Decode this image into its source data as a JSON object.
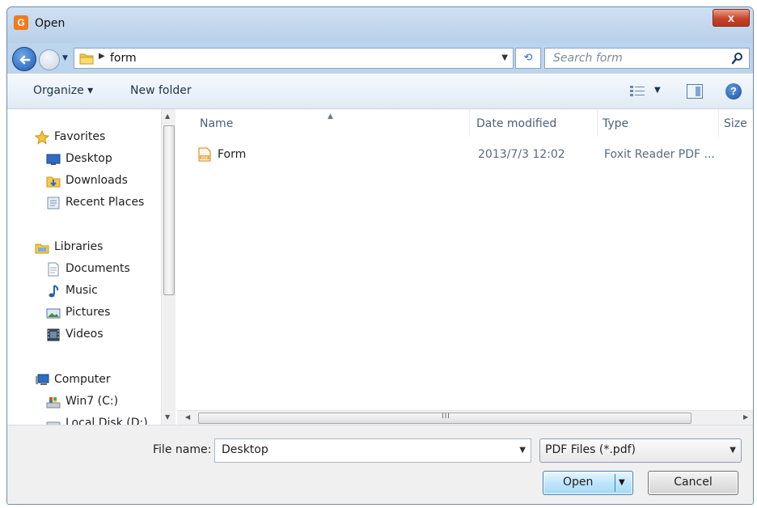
{
  "window": {
    "title": "Open",
    "app_icon_letter": "G",
    "close_label": "x"
  },
  "navigation": {
    "breadcrumb": "form",
    "search_placeholder": "Search form"
  },
  "toolbar": {
    "organize_label": "Organize ▾",
    "new_folder_label": "New folder"
  },
  "sidebar": {
    "favorites": {
      "label": "Favorites",
      "icon": "star-icon"
    },
    "favorites_items": [
      {
        "label": "Desktop",
        "icon": "desktop-icon"
      },
      {
        "label": "Downloads",
        "icon": "downloads-icon"
      },
      {
        "label": "Recent Places",
        "icon": "recent-places-icon"
      }
    ],
    "libraries": {
      "label": "Libraries",
      "icon": "libraries-icon"
    },
    "libraries_items": [
      {
        "label": "Documents",
        "icon": "documents-icon"
      },
      {
        "label": "Music",
        "icon": "music-icon"
      },
      {
        "label": "Pictures",
        "icon": "pictures-icon"
      },
      {
        "label": "Videos",
        "icon": "videos-icon"
      }
    ],
    "computer": {
      "label": "Computer",
      "icon": "computer-icon"
    },
    "computer_items": [
      {
        "label": "Win7 (C:)",
        "icon": "drive-c-icon"
      },
      {
        "label": "Local Disk (D:)",
        "icon": "drive-d-icon"
      }
    ]
  },
  "file_list": {
    "columns": [
      "Name",
      "Date modified",
      "Type",
      "Size"
    ],
    "rows": [
      {
        "name": "Form",
        "date_modified": "2013/7/3 12:02",
        "type": "Foxit Reader PDF ...",
        "size": ""
      }
    ],
    "scroll_grip": "III"
  },
  "footer": {
    "file_name_label": "File name:",
    "file_name_value": "Desktop",
    "file_type_filter": "PDF Files (*.pdf)",
    "open_label": "Open",
    "cancel_label": "Cancel"
  },
  "colors": {
    "frame": "#bcd4ec",
    "close_button": "#c8432a",
    "open_button": "#bee6fd",
    "app_icon": "#f07a1e"
  }
}
